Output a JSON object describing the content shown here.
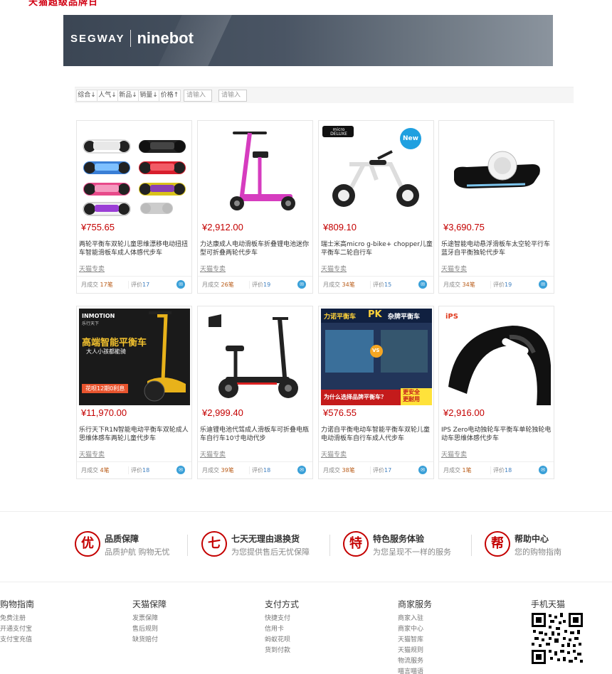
{
  "top_logo": "天猫超级品牌日",
  "banner": {
    "brand_left": "SEGWAY",
    "brand_right": "ninebot"
  },
  "sortbar": {
    "sorts": [
      "综合↓",
      "人气↓",
      "新品↓",
      "销量↓",
      "价格↑"
    ],
    "price_min_placeholder": "请输入",
    "price_max_placeholder": "请输入"
  },
  "products": [
    {
      "price": "¥755.65",
      "title": "两轮平衡车双轮儿童思维漂移电动扭扭车智能滑板车成人体感代步车",
      "shop": "天猫专卖",
      "sales_label": "月成交",
      "sales": "17笔",
      "reviews_label": "评价",
      "reviews": "17"
    },
    {
      "price": "¥2,912.00",
      "title": "力达康成人电动滑板车折叠锂电池迷你型可折叠两轮代步车",
      "shop": "天猫专卖",
      "sales_label": "月成交",
      "sales": "26笔",
      "reviews_label": "评价",
      "reviews": "19"
    },
    {
      "price": "¥809.10",
      "title": "瑞士米高micro g-bike+ chopper儿童平衡车二轮自行车",
      "shop": "天猫专卖",
      "sales_label": "月成交",
      "sales": "34笔",
      "reviews_label": "评价",
      "reviews": "15",
      "badge": "New",
      "logo": "micro DELUXE"
    },
    {
      "price": "¥3,690.75",
      "title": "乐途智能电动悬浮滑板车太空轮平行车蓝牙自平衡独轮代步车",
      "shop": "天猫专卖",
      "sales_label": "月成交",
      "sales": "34笔",
      "reviews_label": "评价",
      "reviews": "19"
    },
    {
      "price": "¥11,970.00",
      "title": "乐行天下R1N智能电动平衡车双轮成人思维体感车两轮儿童代步车",
      "shop": "天猫专卖",
      "sales_label": "月成交",
      "sales": "4笔",
      "reviews_label": "评价",
      "reviews": "18",
      "img_brand": "INMOTION",
      "img_brand_sub": "乐行天下",
      "img_headline": "高端智能平衡车",
      "img_sub": "大人小孩都能骑",
      "img_tag": "花呗12期0利息"
    },
    {
      "price": "¥2,999.40",
      "title": "乐迪锂电池代驾成人滑板车可折叠电瓶车自行车10寸电动代步",
      "shop": "天猫专卖",
      "sales_label": "月成交",
      "sales": "39笔",
      "reviews_label": "评价",
      "reviews": "18"
    },
    {
      "price": "¥576.55",
      "title": "力诺自平衡电动车智能平衡车双轮儿童电动滑板车自行车成人代步车",
      "shop": "天猫专卖",
      "sales_label": "月成交",
      "sales": "38笔",
      "reviews_label": "评价",
      "reviews": "17",
      "img_top_left": "力诺平衡车",
      "img_top_pk": "PK",
      "img_top_right": "杂牌平衡车",
      "img_vs": "VS",
      "img_bottom": "为什么选择品牌平衡车？",
      "img_safe": "更安全\n更耐用"
    },
    {
      "price": "¥2,916.00",
      "title": "IPS Zero电动独轮车平衡车单轮独轮电动车思维体感代步车",
      "shop": "天猫专卖",
      "sales_label": "月成交",
      "sales": "1笔",
      "reviews_label": "评价",
      "reviews": "18",
      "img_logo": "iPS"
    }
  ],
  "guarantees": [
    {
      "icon": "优",
      "title": "品质保障",
      "sub": "品质护航 购物无忧"
    },
    {
      "icon": "七",
      "title": "七天无理由退换货",
      "sub": "为您提供售后无忧保障"
    },
    {
      "icon": "特",
      "title": "特色服务体验",
      "sub": "为您呈现不一样的服务"
    },
    {
      "icon": "帮",
      "title": "帮助中心",
      "sub": "您的购物指南"
    }
  ],
  "footer": [
    {
      "heading": "购物指南",
      "items": [
        "免费注册",
        "开通支付宝",
        "支付宝充值"
      ]
    },
    {
      "heading": "天猫保障",
      "items": [
        "发票保障",
        "售后规则",
        "缺货赔付"
      ]
    },
    {
      "heading": "支付方式",
      "items": [
        "快捷支付",
        "信用卡",
        "蚂蚁花呗",
        "货到付款"
      ]
    },
    {
      "heading": "商家服务",
      "items": [
        "商家入驻",
        "商家中心",
        "天猫智库",
        "天猫规则",
        "物流服务",
        "喵言喵语"
      ]
    },
    {
      "heading": "手机天猫",
      "items": []
    }
  ],
  "colors": {
    "price": "#c40000",
    "brand_red": "#d10013",
    "sales": "#b85a16",
    "reviews": "#3f7fc0"
  }
}
